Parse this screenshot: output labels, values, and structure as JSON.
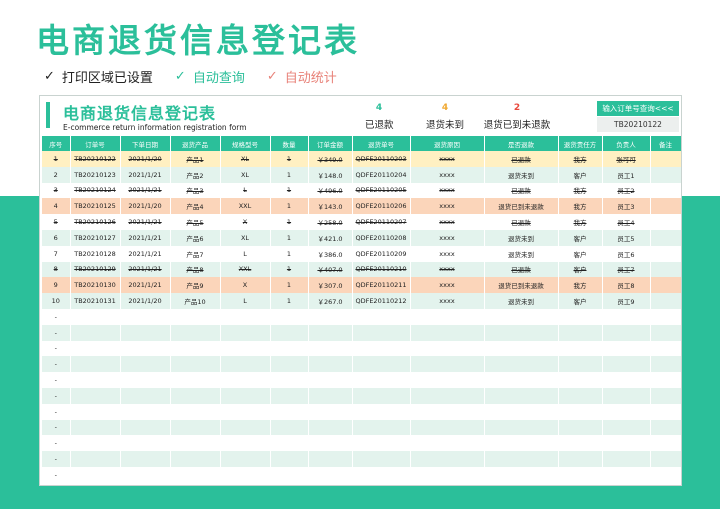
{
  "page_title": "电商退货信息登记表",
  "features": [
    {
      "label": "打印区域已设置",
      "color": "#222222",
      "check": "✓"
    },
    {
      "label": "自动查询",
      "color": "#2bbf9a",
      "check": "✓"
    },
    {
      "label": "自动统计",
      "color": "#e8837a",
      "check": "✓"
    }
  ],
  "sheet": {
    "title": "电商退货信息登记表",
    "subtitle": "E-commerce return information registration form",
    "stats": [
      {
        "value": "4",
        "label": "已退款",
        "color": "#2bbf9a"
      },
      {
        "value": "4",
        "label": "退货未到",
        "color": "#f0a830"
      },
      {
        "value": "2",
        "label": "退货已到未退款",
        "color": "#e8473c"
      }
    ],
    "query_button": "输入订单号查询<<<",
    "query_value": "TB20210122"
  },
  "colors": {
    "accent": "#2bbf9a",
    "yellow_row": "#fff0c2",
    "orange_row": "#fbd5ba",
    "even_row": "#e3f3ed"
  },
  "table": {
    "headers": [
      "序号",
      "订单号",
      "下单日期",
      "退货产品",
      "规格型号",
      "数量",
      "订单金额",
      "退货单号",
      "退货原因",
      "是否退款",
      "退货责任方",
      "负责人",
      "备注"
    ],
    "rows": [
      {
        "cells": [
          "1",
          "TB20210122",
          "2021/1/20",
          "产品1",
          "XL",
          "1",
          "￥349.0",
          "QDFE20110203",
          "xxxx",
          "已退款",
          "我方",
          "张可可",
          ""
        ],
        "style": "yellow",
        "strike": true
      },
      {
        "cells": [
          "2",
          "TB20210123",
          "2021/1/21",
          "产品2",
          "XL",
          "1",
          "￥148.0",
          "QDFE20110204",
          "xxxx",
          "退货未到",
          "客户",
          "员工1",
          ""
        ],
        "style": "even",
        "strike": false
      },
      {
        "cells": [
          "3",
          "TB20210124",
          "2021/1/21",
          "产品3",
          "L",
          "1",
          "￥496.0",
          "QDFE20110205",
          "xxxx",
          "已退款",
          "我方",
          "员工2",
          ""
        ],
        "style": "odd",
        "strike": true
      },
      {
        "cells": [
          "4",
          "TB20210125",
          "2021/1/20",
          "产品4",
          "XXL",
          "1",
          "￥143.0",
          "QDFE20110206",
          "xxxx",
          "退货已到未退款",
          "我方",
          "员工3",
          ""
        ],
        "style": "orange",
        "strike": false
      },
      {
        "cells": [
          "5",
          "TB20210126",
          "2021/1/21",
          "产品5",
          "X",
          "1",
          "￥258.0",
          "QDFE20110207",
          "xxxx",
          "已退款",
          "我方",
          "员工4",
          ""
        ],
        "style": "odd",
        "strike": true
      },
      {
        "cells": [
          "6",
          "TB20210127",
          "2021/1/21",
          "产品6",
          "XL",
          "1",
          "￥421.0",
          "QDFE20110208",
          "xxxx",
          "退货未到",
          "客户",
          "员工5",
          ""
        ],
        "style": "even",
        "strike": false
      },
      {
        "cells": [
          "7",
          "TB20210128",
          "2021/1/21",
          "产品7",
          "L",
          "1",
          "￥386.0",
          "QDFE20110209",
          "xxxx",
          "退货未到",
          "客户",
          "员工6",
          ""
        ],
        "style": "odd",
        "strike": false
      },
      {
        "cells": [
          "8",
          "TB20210129",
          "2021/1/21",
          "产品8",
          "XXL",
          "1",
          "￥407.0",
          "QDFE20110210",
          "xxxx",
          "已退款",
          "客户",
          "员工7",
          ""
        ],
        "style": "even",
        "strike": true
      },
      {
        "cells": [
          "9",
          "TB20210130",
          "2021/1/21",
          "产品9",
          "X",
          "1",
          "￥307.0",
          "QDFE20110211",
          "xxxx",
          "退货已到未退款",
          "我方",
          "员工8",
          ""
        ],
        "style": "orange",
        "strike": false
      },
      {
        "cells": [
          "10",
          "TB20210131",
          "2021/1/20",
          "产品10",
          "L",
          "1",
          "￥267.0",
          "QDFE20110212",
          "xxxx",
          "退货未到",
          "客户",
          "员工9",
          ""
        ],
        "style": "even",
        "strike": false
      }
    ],
    "empty_marker": "-",
    "empty_row_count": 11
  }
}
